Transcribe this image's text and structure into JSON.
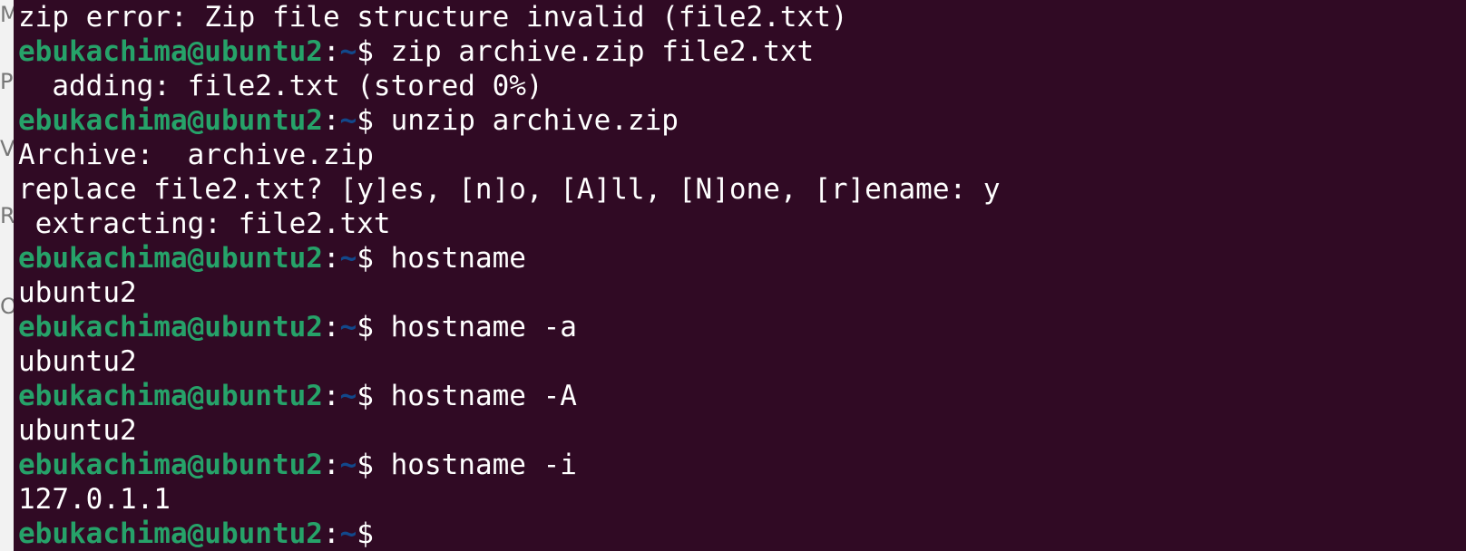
{
  "background_window": {
    "fragments": [
      "M",
      "Pi",
      "V",
      "R",
      "O"
    ]
  },
  "terminal": {
    "colors": {
      "background": "#300a24",
      "prompt_user": "#26a269",
      "prompt_path": "#12488b",
      "text": "#ffffff"
    },
    "lines": [
      {
        "type": "output",
        "text": "zip error: Zip file structure invalid (file2.txt)"
      },
      {
        "type": "prompt",
        "user": "ebukachima@ubuntu2",
        "colon": ":",
        "path": "~",
        "symbol": "$ ",
        "command": "zip archive.zip file2.txt"
      },
      {
        "type": "output",
        "text": "  adding: file2.txt (stored 0%)"
      },
      {
        "type": "prompt",
        "user": "ebukachima@ubuntu2",
        "colon": ":",
        "path": "~",
        "symbol": "$ ",
        "command": "unzip archive.zip"
      },
      {
        "type": "output",
        "text": "Archive:  archive.zip"
      },
      {
        "type": "output",
        "text": "replace file2.txt? [y]es, [n]o, [A]ll, [N]one, [r]ename: y"
      },
      {
        "type": "output",
        "text": " extracting: file2.txt"
      },
      {
        "type": "prompt",
        "user": "ebukachima@ubuntu2",
        "colon": ":",
        "path": "~",
        "symbol": "$ ",
        "command": "hostname"
      },
      {
        "type": "output",
        "text": "ubuntu2"
      },
      {
        "type": "prompt",
        "user": "ebukachima@ubuntu2",
        "colon": ":",
        "path": "~",
        "symbol": "$ ",
        "command": "hostname -a"
      },
      {
        "type": "output",
        "text": "ubuntu2"
      },
      {
        "type": "prompt",
        "user": "ebukachima@ubuntu2",
        "colon": ":",
        "path": "~",
        "symbol": "$ ",
        "command": "hostname -A"
      },
      {
        "type": "output",
        "text": "ubuntu2"
      },
      {
        "type": "prompt",
        "user": "ebukachima@ubuntu2",
        "colon": ":",
        "path": "~",
        "symbol": "$ ",
        "command": "hostname -i"
      },
      {
        "type": "output",
        "text": "127.0.1.1"
      },
      {
        "type": "prompt",
        "user": "ebukachima@ubuntu2",
        "colon": ":",
        "path": "~",
        "symbol": "$ ",
        "command": ""
      }
    ]
  }
}
